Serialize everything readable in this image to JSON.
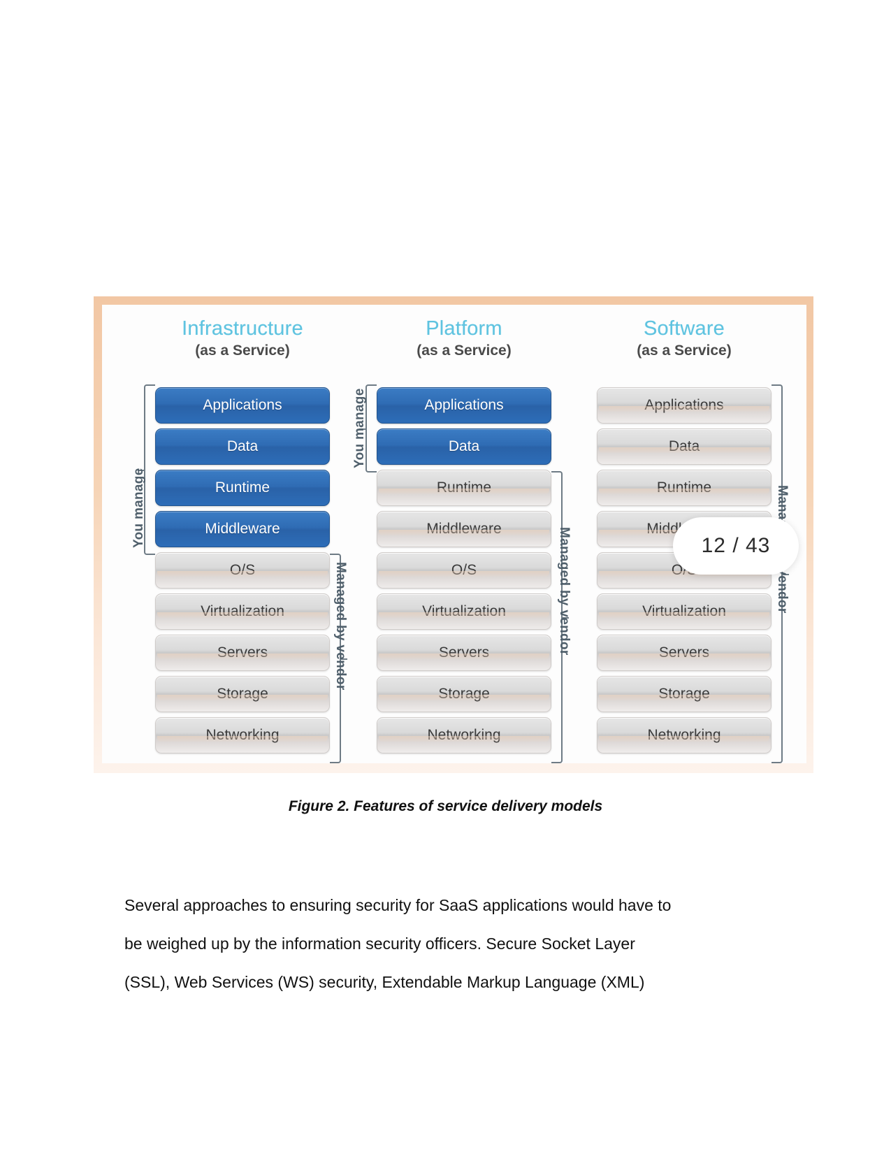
{
  "page": {
    "badge_label": "12 / 43",
    "clipped_fragment": "· ·   ·   ·  ·    ·  ·"
  },
  "figure": {
    "caption": "Figure 2. Features of service delivery models",
    "columns": [
      {
        "id": "iaas",
        "title": "Infrastructure",
        "subtitle": "(as a Service)",
        "rows": [
          {
            "label": "Applications",
            "managed_by": "you"
          },
          {
            "label": "Data",
            "managed_by": "you"
          },
          {
            "label": "Runtime",
            "managed_by": "you"
          },
          {
            "label": "Middleware",
            "managed_by": "you"
          },
          {
            "label": "O/S",
            "managed_by": "vendor"
          },
          {
            "label": "Virtualization",
            "managed_by": "vendor"
          },
          {
            "label": "Servers",
            "managed_by": "vendor"
          },
          {
            "label": "Storage",
            "managed_by": "vendor"
          },
          {
            "label": "Networking",
            "managed_by": "vendor"
          }
        ],
        "you_manage_label": "You manage",
        "vendor_label": "Managed by vendor"
      },
      {
        "id": "paas",
        "title": "Platform",
        "subtitle": "(as a Service)",
        "rows": [
          {
            "label": "Applications",
            "managed_by": "you"
          },
          {
            "label": "Data",
            "managed_by": "you"
          },
          {
            "label": "Runtime",
            "managed_by": "vendor"
          },
          {
            "label": "Middleware",
            "managed_by": "vendor"
          },
          {
            "label": "O/S",
            "managed_by": "vendor"
          },
          {
            "label": "Virtualization",
            "managed_by": "vendor"
          },
          {
            "label": "Servers",
            "managed_by": "vendor"
          },
          {
            "label": "Storage",
            "managed_by": "vendor"
          },
          {
            "label": "Networking",
            "managed_by": "vendor"
          }
        ],
        "you_manage_label": "You manage",
        "vendor_label": "Managed by vendor"
      },
      {
        "id": "saas",
        "title": "Software",
        "subtitle": "(as a Service)",
        "rows": [
          {
            "label": "Applications",
            "managed_by": "vendor"
          },
          {
            "label": "Data",
            "managed_by": "vendor"
          },
          {
            "label": "Runtime",
            "managed_by": "vendor"
          },
          {
            "label": "Middleware",
            "managed_by": "vendor"
          },
          {
            "label": "O/S",
            "managed_by": "vendor"
          },
          {
            "label": "Virtualization",
            "managed_by": "vendor"
          },
          {
            "label": "Servers",
            "managed_by": "vendor"
          },
          {
            "label": "Storage",
            "managed_by": "vendor"
          },
          {
            "label": "Networking",
            "managed_by": "vendor"
          }
        ],
        "you_manage_label": "",
        "vendor_label": "Managed by vendor"
      }
    ],
    "colors": {
      "title_accent": "#5ec3e0",
      "managed_by_you": "#2f6cb4",
      "managed_by_vendor": "#dadada",
      "frame": "#f2c7a4",
      "bracket": "#6e7b85"
    }
  },
  "body": {
    "paragraph_lines": [
      "Several approaches to ensuring security for SaaS applications would have to",
      "be weighed up by the information security officers. Secure Socket Layer",
      "(SSL), Web Services (WS) security, Extendable Markup Language (XML)"
    ]
  }
}
